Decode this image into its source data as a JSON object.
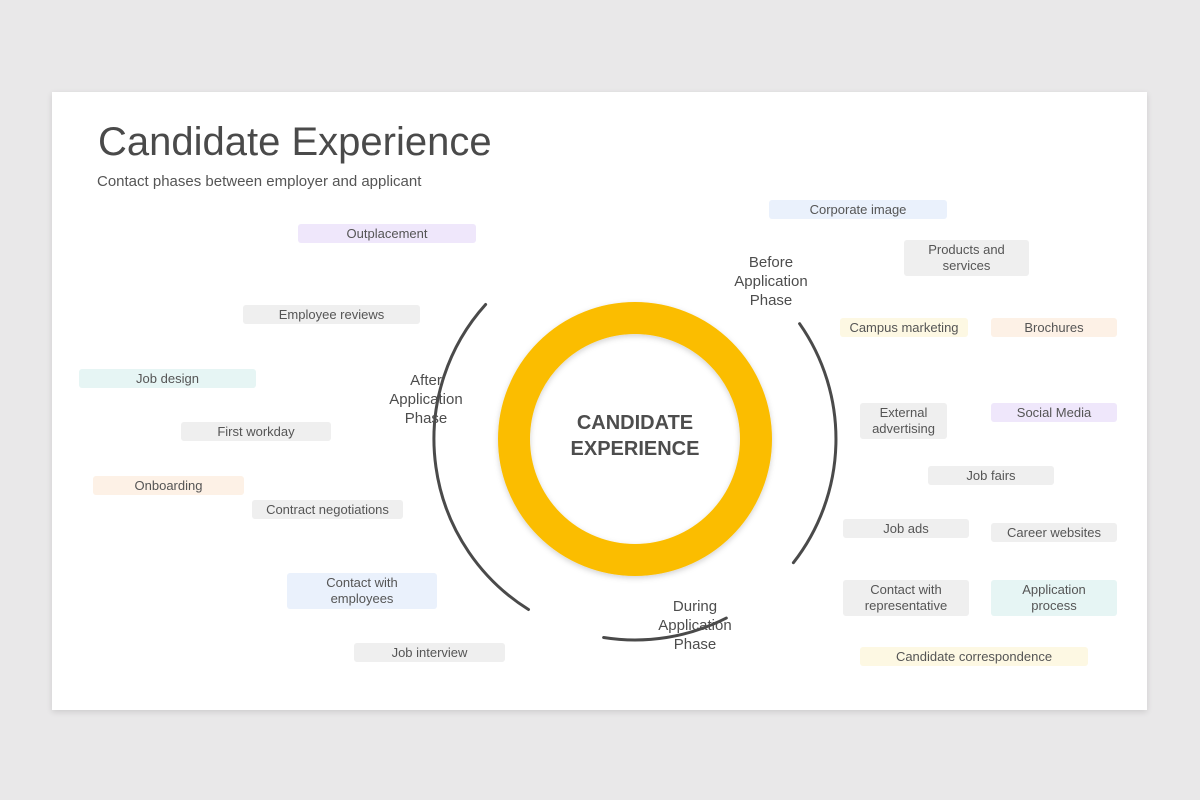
{
  "title": "Candidate Experience",
  "subtitle": "Contact phases between employer and applicant",
  "center": {
    "line1": "CANDIDATE",
    "line2": "EXPERIENCE"
  },
  "colors": {
    "ring": "#fbbd00",
    "arc": "#4a4a4a",
    "gray_tag": "#efefef",
    "blue_tag": "#eaf1fc",
    "purple_tag": "#efe7fb",
    "teal_tag": "#e6f5f4",
    "orange_tag": "#fdf1e6",
    "yellow_tag": "#fdf8e3"
  },
  "phases": {
    "before": {
      "line1": "Before",
      "line2": "Application",
      "line3": "Phase"
    },
    "during": {
      "line1": "During",
      "line2": "Application",
      "line3": "Phase"
    },
    "after": {
      "line1": "After",
      "line2": "Application",
      "line3": "Phase"
    }
  },
  "tags": {
    "corporate_image": "Corporate image",
    "products_services_1": "Products and",
    "products_services_2": "services",
    "campus_marketing": "Campus marketing",
    "brochures": "Brochures",
    "external_advertising_1": "External",
    "external_advertising_2": "advertising",
    "social_media": "Social Media",
    "job_fairs": "Job fairs",
    "job_ads": "Job ads",
    "career_websites": "Career websites",
    "contact_representative_1": "Contact with",
    "contact_representative_2": "representative",
    "application_process_1": "Application",
    "application_process_2": "process",
    "candidate_correspondence": "Candidate correspondence",
    "outplacement": "Outplacement",
    "employee_reviews": "Employee reviews",
    "job_design": "Job design",
    "first_workday": "First workday",
    "onboarding": "Onboarding",
    "contract_negotiations": "Contract negotiations",
    "contact_employees_1": "Contact with",
    "contact_employees_2": "employees",
    "job_interview": "Job interview"
  }
}
